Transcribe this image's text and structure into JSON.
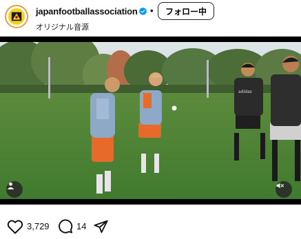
{
  "header": {
    "username": "japanfootballassociation",
    "separator": "•",
    "follow_label": "フォロー中",
    "audio_label": "オリジナル音源"
  },
  "video": {
    "shirt_text": "adidas"
  },
  "actions": {
    "like_count": "3,729",
    "comment_count": "14"
  },
  "icons": {
    "verified": "verified-badge-icon",
    "user_tag": "user-tag-icon",
    "mute": "mute-icon",
    "like": "heart-icon",
    "comment": "comment-icon",
    "share": "share-icon"
  },
  "colors": {
    "verified": "#0095f6",
    "accent": "#f6d21a"
  }
}
